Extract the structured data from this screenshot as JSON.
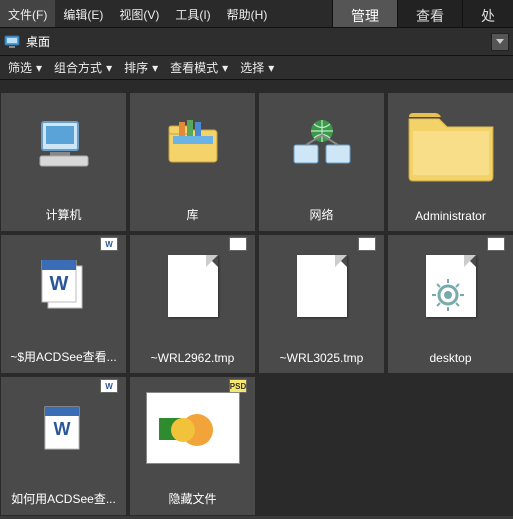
{
  "menubar": {
    "items": [
      {
        "label": "文件(F)"
      },
      {
        "label": "编辑(E)"
      },
      {
        "label": "视图(V)"
      },
      {
        "label": "工具(I)"
      },
      {
        "label": "帮助(H)"
      }
    ],
    "tabs": [
      {
        "label": "管理",
        "active": true
      },
      {
        "label": "查看",
        "active": false
      },
      {
        "label": "处",
        "active": false
      }
    ]
  },
  "addressbar": {
    "path": "桌面"
  },
  "toolbar": {
    "items": [
      {
        "label": "筛选"
      },
      {
        "label": "组合方式"
      },
      {
        "label": "排序"
      },
      {
        "label": "查看模式"
      },
      {
        "label": "选择"
      }
    ]
  },
  "grid": {
    "items": [
      {
        "kind": "computer",
        "label": "计算机"
      },
      {
        "kind": "library",
        "label": "库"
      },
      {
        "kind": "network",
        "label": "网络"
      },
      {
        "kind": "folder",
        "label": "Administrator"
      },
      {
        "kind": "partial-folder",
        "label": ""
      },
      {
        "kind": "word-doc",
        "label": "~$用ACDSee查看..."
      },
      {
        "kind": "tmp-file",
        "label": "~WRL2962.tmp"
      },
      {
        "kind": "tmp-file",
        "label": "~WRL3025.tmp"
      },
      {
        "kind": "ini-file",
        "label": "desktop"
      },
      {
        "kind": "empty",
        "label": ""
      },
      {
        "kind": "word-doc",
        "label": "如何用ACDSee查..."
      },
      {
        "kind": "psd-file",
        "label": "隐藏文件"
      }
    ]
  },
  "badges": {
    "doc": "W",
    "psd": "PSD"
  }
}
